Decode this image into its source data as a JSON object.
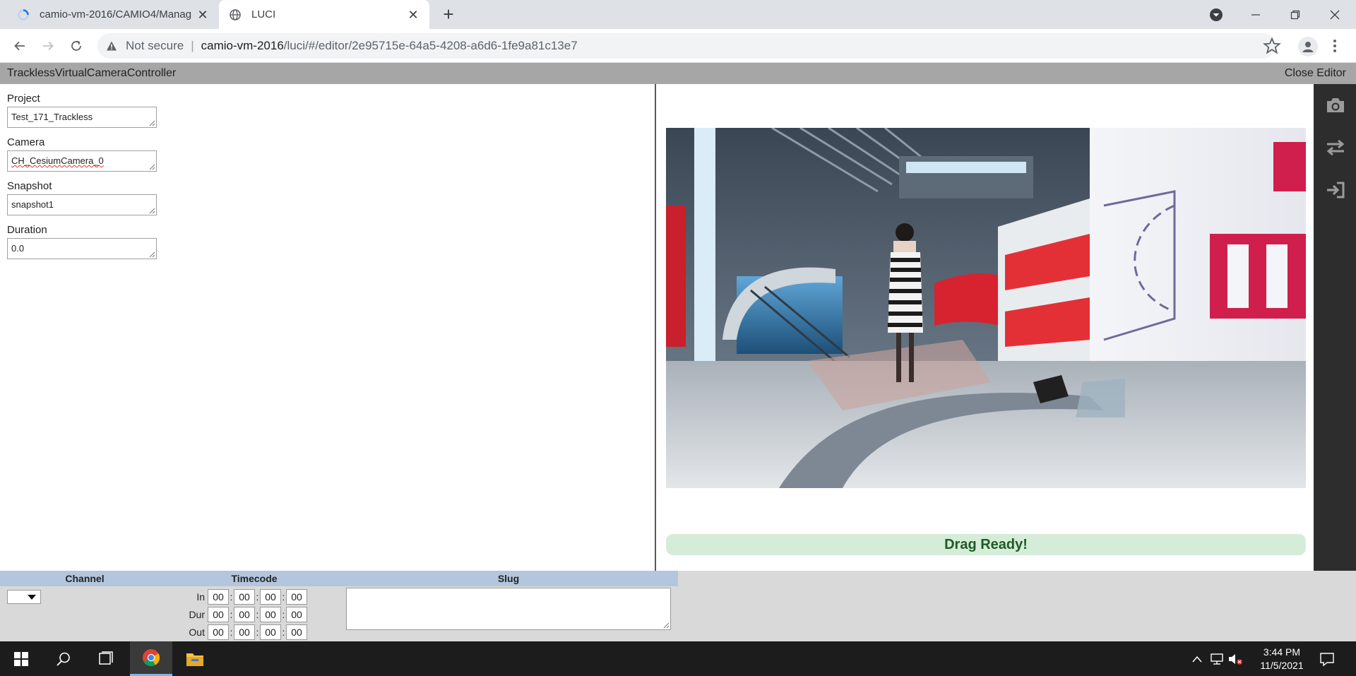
{
  "browser": {
    "tabs": [
      {
        "title": "camio-vm-2016/CAMIO4/Manag",
        "favicon": "loading-spinner-icon",
        "active": false
      },
      {
        "title": "LUCI",
        "favicon": "globe-icon",
        "active": true
      }
    ],
    "address": {
      "security_label": "Not secure",
      "host": "camio-vm-2016",
      "path": "/luci/#/editor/2e95715e-64a5-4208-a6d6-1fe9a81c13e7"
    }
  },
  "app": {
    "title": "TracklessVirtualCameraController",
    "close_label": "Close Editor"
  },
  "form": {
    "project": {
      "label": "Project",
      "value": "Test_171_Trackless"
    },
    "camera": {
      "label": "Camera",
      "value": "CH_CesiumCamera_0"
    },
    "snapshot": {
      "label": "Snapshot",
      "value": "snapshot1"
    },
    "duration": {
      "label": "Duration",
      "value": "0.0"
    }
  },
  "preview": {
    "status": "Drag Ready!",
    "status_color": "#d5ecd9"
  },
  "rail": {
    "buttons": [
      "camera-icon",
      "swap-arrows-icon",
      "sign-in-icon"
    ]
  },
  "bottom": {
    "headers": {
      "channel": "Channel",
      "timecode": "Timecode",
      "slug": "Slug"
    },
    "rows": [
      {
        "label": "In",
        "hh": "00",
        "mm": "00",
        "ss": "00",
        "ff": "00"
      },
      {
        "label": "Dur",
        "hh": "00",
        "mm": "00",
        "ss": "00",
        "ff": "00"
      },
      {
        "label": "Out",
        "hh": "00",
        "mm": "00",
        "ss": "00",
        "ff": "00"
      }
    ],
    "separator": ":"
  },
  "taskbar": {
    "time": "3:44 PM",
    "date": "11/5/2021"
  }
}
